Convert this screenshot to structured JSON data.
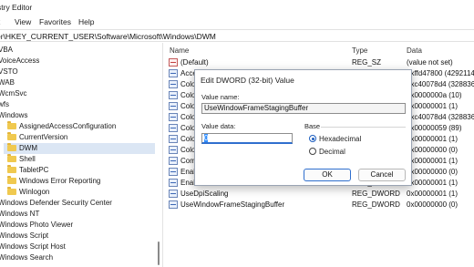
{
  "window": {
    "title": "stry Editor"
  },
  "menu": [
    "it",
    "View",
    "Favorites",
    "Help"
  ],
  "address": "er\\HKEY_CURRENT_USER\\Software\\Microsoft\\Windows\\DWM",
  "tree": [
    {
      "label": "VBA",
      "indent": 0,
      "folder": false
    },
    {
      "label": "VoiceAccess",
      "indent": 0,
      "folder": false
    },
    {
      "label": "VSTO",
      "indent": 0,
      "folder": false
    },
    {
      "label": "WAB",
      "indent": 0,
      "folder": false
    },
    {
      "label": "WcmSvc",
      "indent": 0,
      "folder": false
    },
    {
      "label": "wfs",
      "indent": 0,
      "folder": false
    },
    {
      "label": "Windows",
      "indent": 0,
      "folder": false
    },
    {
      "label": "AssignedAccessConfiguration",
      "indent": 1,
      "folder": true
    },
    {
      "label": "CurrentVersion",
      "indent": 1,
      "folder": true
    },
    {
      "label": "DWM",
      "indent": 1,
      "folder": true,
      "selected": true
    },
    {
      "label": "Shell",
      "indent": 1,
      "folder": true
    },
    {
      "label": "TabletPC",
      "indent": 1,
      "folder": true
    },
    {
      "label": "Windows Error Reporting",
      "indent": 1,
      "folder": true
    },
    {
      "label": "Winlogon",
      "indent": 1,
      "folder": true
    },
    {
      "label": "Windows Defender Security Center",
      "indent": 0,
      "folder": false
    },
    {
      "label": "Windows NT",
      "indent": 0,
      "folder": false
    },
    {
      "label": "Windows Photo Viewer",
      "indent": 0,
      "folder": false
    },
    {
      "label": "Windows Script",
      "indent": 0,
      "folder": false
    },
    {
      "label": "Windows Script Host",
      "indent": 0,
      "folder": false
    },
    {
      "label": "Windows Search",
      "indent": 0,
      "folder": false
    }
  ],
  "columns": {
    "name": "Name",
    "type": "Type",
    "data": "Data"
  },
  "values": [
    {
      "name": "(Default)",
      "type": "REG_SZ",
      "data": "(value not set)",
      "icon": "string"
    },
    {
      "name": "Acce",
      "type": "",
      "data": "0xffd47800 (4292114",
      "icon": "dword"
    },
    {
      "name": "Colo",
      "type": "",
      "data": "0xc40078d4 (328836",
      "icon": "dword"
    },
    {
      "name": "Colo",
      "type": "",
      "data": "0x0000000a (10)",
      "icon": "dword"
    },
    {
      "name": "Colo",
      "type": "",
      "data": "0x00000001 (1)",
      "icon": "dword"
    },
    {
      "name": "Colo",
      "type": "",
      "data": "0xc40078d4 (328836",
      "icon": "dword"
    },
    {
      "name": "Colo",
      "type": "",
      "data": "0x00000059 (89)",
      "icon": "dword"
    },
    {
      "name": "Colo",
      "type": "",
      "data": "0x00000001 (1)",
      "icon": "dword"
    },
    {
      "name": "Colo",
      "type": "",
      "data": "0x00000000 (0)",
      "icon": "dword"
    },
    {
      "name": "Com",
      "type": "",
      "data": "0x00000001 (1)",
      "icon": "dword"
    },
    {
      "name": "Enab",
      "type": "",
      "data": "0x00000000 (0)",
      "icon": "dword"
    },
    {
      "name": "EnableWindowColorization",
      "type": "REG_DWORD",
      "data": "0x00000001 (1)",
      "icon": "dword"
    },
    {
      "name": "UseDpiScaling",
      "type": "REG_DWORD",
      "data": "0x00000001 (1)",
      "icon": "dword"
    },
    {
      "name": "UseWindowFrameStagingBuffer",
      "type": "REG_DWORD",
      "data": "0x00000000 (0)",
      "icon": "dword"
    }
  ],
  "dialog": {
    "title": "Edit DWORD (32-bit) Value",
    "value_name_label": "Value name:",
    "value_name": "UseWindowFrameStagingBuffer",
    "value_data_label": "Value data:",
    "value_data": "0",
    "base_label": "Base",
    "hex_label": "Hexadecimal",
    "dec_label": "Decimal",
    "base_selected": "hexadecimal",
    "ok": "OK",
    "cancel": "Cancel"
  }
}
